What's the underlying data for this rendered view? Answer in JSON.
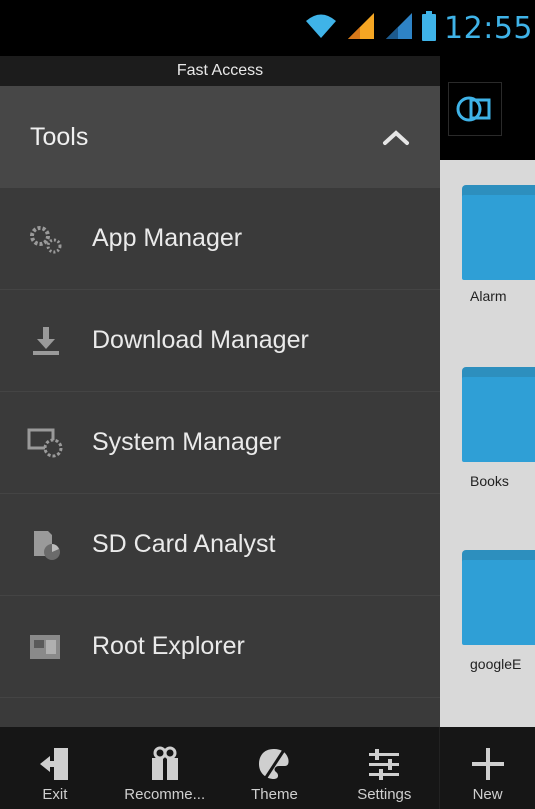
{
  "status_bar": {
    "time": "12:55",
    "icons": [
      "wifi-icon",
      "signal-icon",
      "signal-icon-2",
      "battery-icon"
    ]
  },
  "drawer": {
    "header": "Fast Access",
    "section": {
      "title": "Tools",
      "icon": "chevron-up-icon"
    },
    "items": [
      {
        "label": "App Manager",
        "icon": "app-manager-icon"
      },
      {
        "label": "Download Manager",
        "icon": "download-icon"
      },
      {
        "label": "System Manager",
        "icon": "system-manager-icon"
      },
      {
        "label": "SD Card Analyst",
        "icon": "sd-card-analyst-icon"
      },
      {
        "label": "Root Explorer",
        "icon": "root-explorer-icon"
      }
    ]
  },
  "bottom_bar": {
    "items": [
      {
        "label": "Exit",
        "icon": "exit-icon"
      },
      {
        "label": "Recomme...",
        "icon": "gift-icon"
      },
      {
        "label": "Theme",
        "icon": "theme-icon"
      },
      {
        "label": "Settings",
        "icon": "settings-sliders-icon"
      },
      {
        "label": "New",
        "icon": "plus-icon"
      }
    ]
  },
  "content": {
    "folders": [
      {
        "label": "Alarm"
      },
      {
        "label": "Books"
      },
      {
        "label": "googleE"
      }
    ]
  },
  "colors": {
    "accent": "#3fb3e8",
    "drawer_bg": "#3a3a3a",
    "section_bg": "#474747",
    "folder": "#2f9fd6",
    "content_bg": "#d9d9d9"
  }
}
